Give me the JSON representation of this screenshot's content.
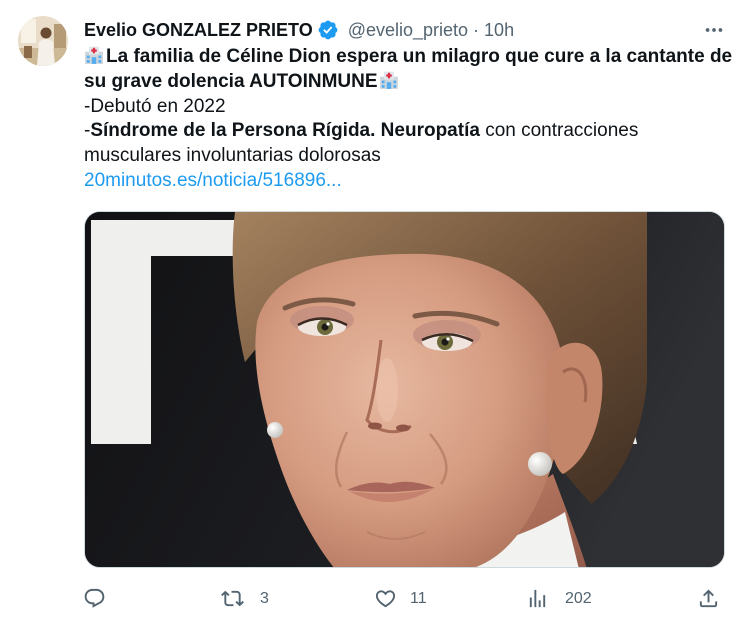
{
  "tweet": {
    "author": {
      "name": "Evelio GONZALEZ PRIETO",
      "verified_icon": "verified-badge-icon",
      "handle": "@evelio_prieto",
      "separator": "·",
      "time": "10h"
    },
    "more_icon": "more-horizontal-icon",
    "body": {
      "emoji_icon": "hospital-emoji-icon",
      "headline": [
        "La familia de Céline Dion espera un milagro que cure a la cantante de",
        "su grave dolencia AUTOINMUNE"
      ],
      "debut": "-Debutó en 2022",
      "condition": {
        "prefix": "-",
        "bold": "Síndrome de la Persona Rígida. Neuropatía",
        "rest": " con contracciones"
      },
      "condition_cont": "musculares involuntarias dolorosas",
      "link": "20minutos.es/noticia/516896..."
    },
    "actions": {
      "reply": {
        "icon": "reply-icon"
      },
      "retweet": {
        "icon": "retweet-icon",
        "count": "3"
      },
      "like": {
        "icon": "heart-icon",
        "count": "11"
      },
      "views": {
        "icon": "views-chart-icon",
        "count": "202"
      },
      "share": {
        "icon": "share-icon"
      }
    }
  },
  "colors": {
    "text": "#0f1419",
    "secondary": "#536471",
    "accent": "#1d9bf0",
    "border": "#cfd9de",
    "background": "#ffffff"
  }
}
